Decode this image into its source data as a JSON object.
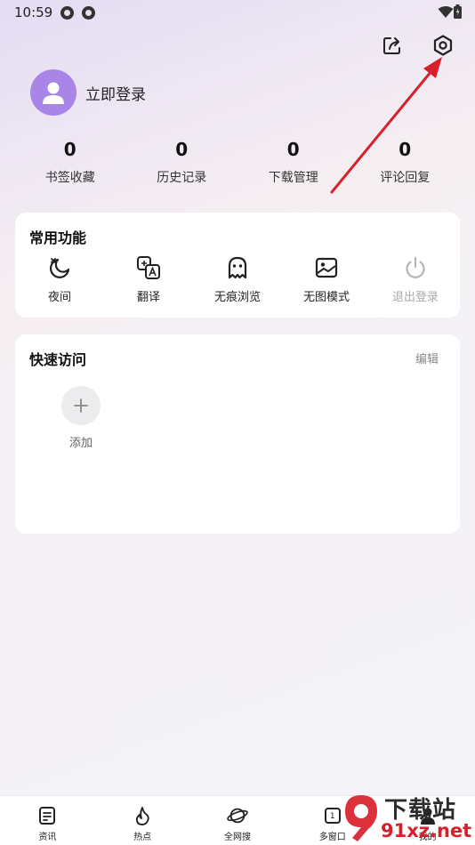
{
  "status_bar": {
    "time": "10:59"
  },
  "header": {
    "share_icon": "share-icon",
    "settings_icon": "settings-gear-icon"
  },
  "profile": {
    "login_text": "立即登录"
  },
  "stats": [
    {
      "value": "0",
      "label": "书签收藏"
    },
    {
      "value": "0",
      "label": "历史记录"
    },
    {
      "value": "0",
      "label": "下载管理"
    },
    {
      "value": "0",
      "label": "评论回复"
    }
  ],
  "common_functions": {
    "title": "常用功能",
    "items": [
      {
        "label": "夜间",
        "icon": "night-mode-icon"
      },
      {
        "label": "翻译",
        "icon": "translate-icon"
      },
      {
        "label": "无痕浏览",
        "icon": "ghost-icon"
      },
      {
        "label": "无图模式",
        "icon": "no-image-icon"
      },
      {
        "label": "退出登录",
        "icon": "power-icon",
        "disabled": true
      }
    ]
  },
  "quick_access": {
    "title": "快速访问",
    "edit_label": "编辑",
    "add_label": "添加"
  },
  "bottom_nav": [
    {
      "label": "资讯",
      "icon": "news-icon"
    },
    {
      "label": "热点",
      "icon": "flame-icon"
    },
    {
      "label": "全网搜",
      "icon": "planet-icon"
    },
    {
      "label": "多窗口",
      "icon": "windows-icon",
      "badge": "1"
    },
    {
      "label": "我的",
      "icon": "user-icon"
    }
  ],
  "watermark": {
    "title": "下载站",
    "url": "91xz.net"
  },
  "colors": {
    "accent": "#a985e8",
    "arrow": "#d8202b"
  }
}
